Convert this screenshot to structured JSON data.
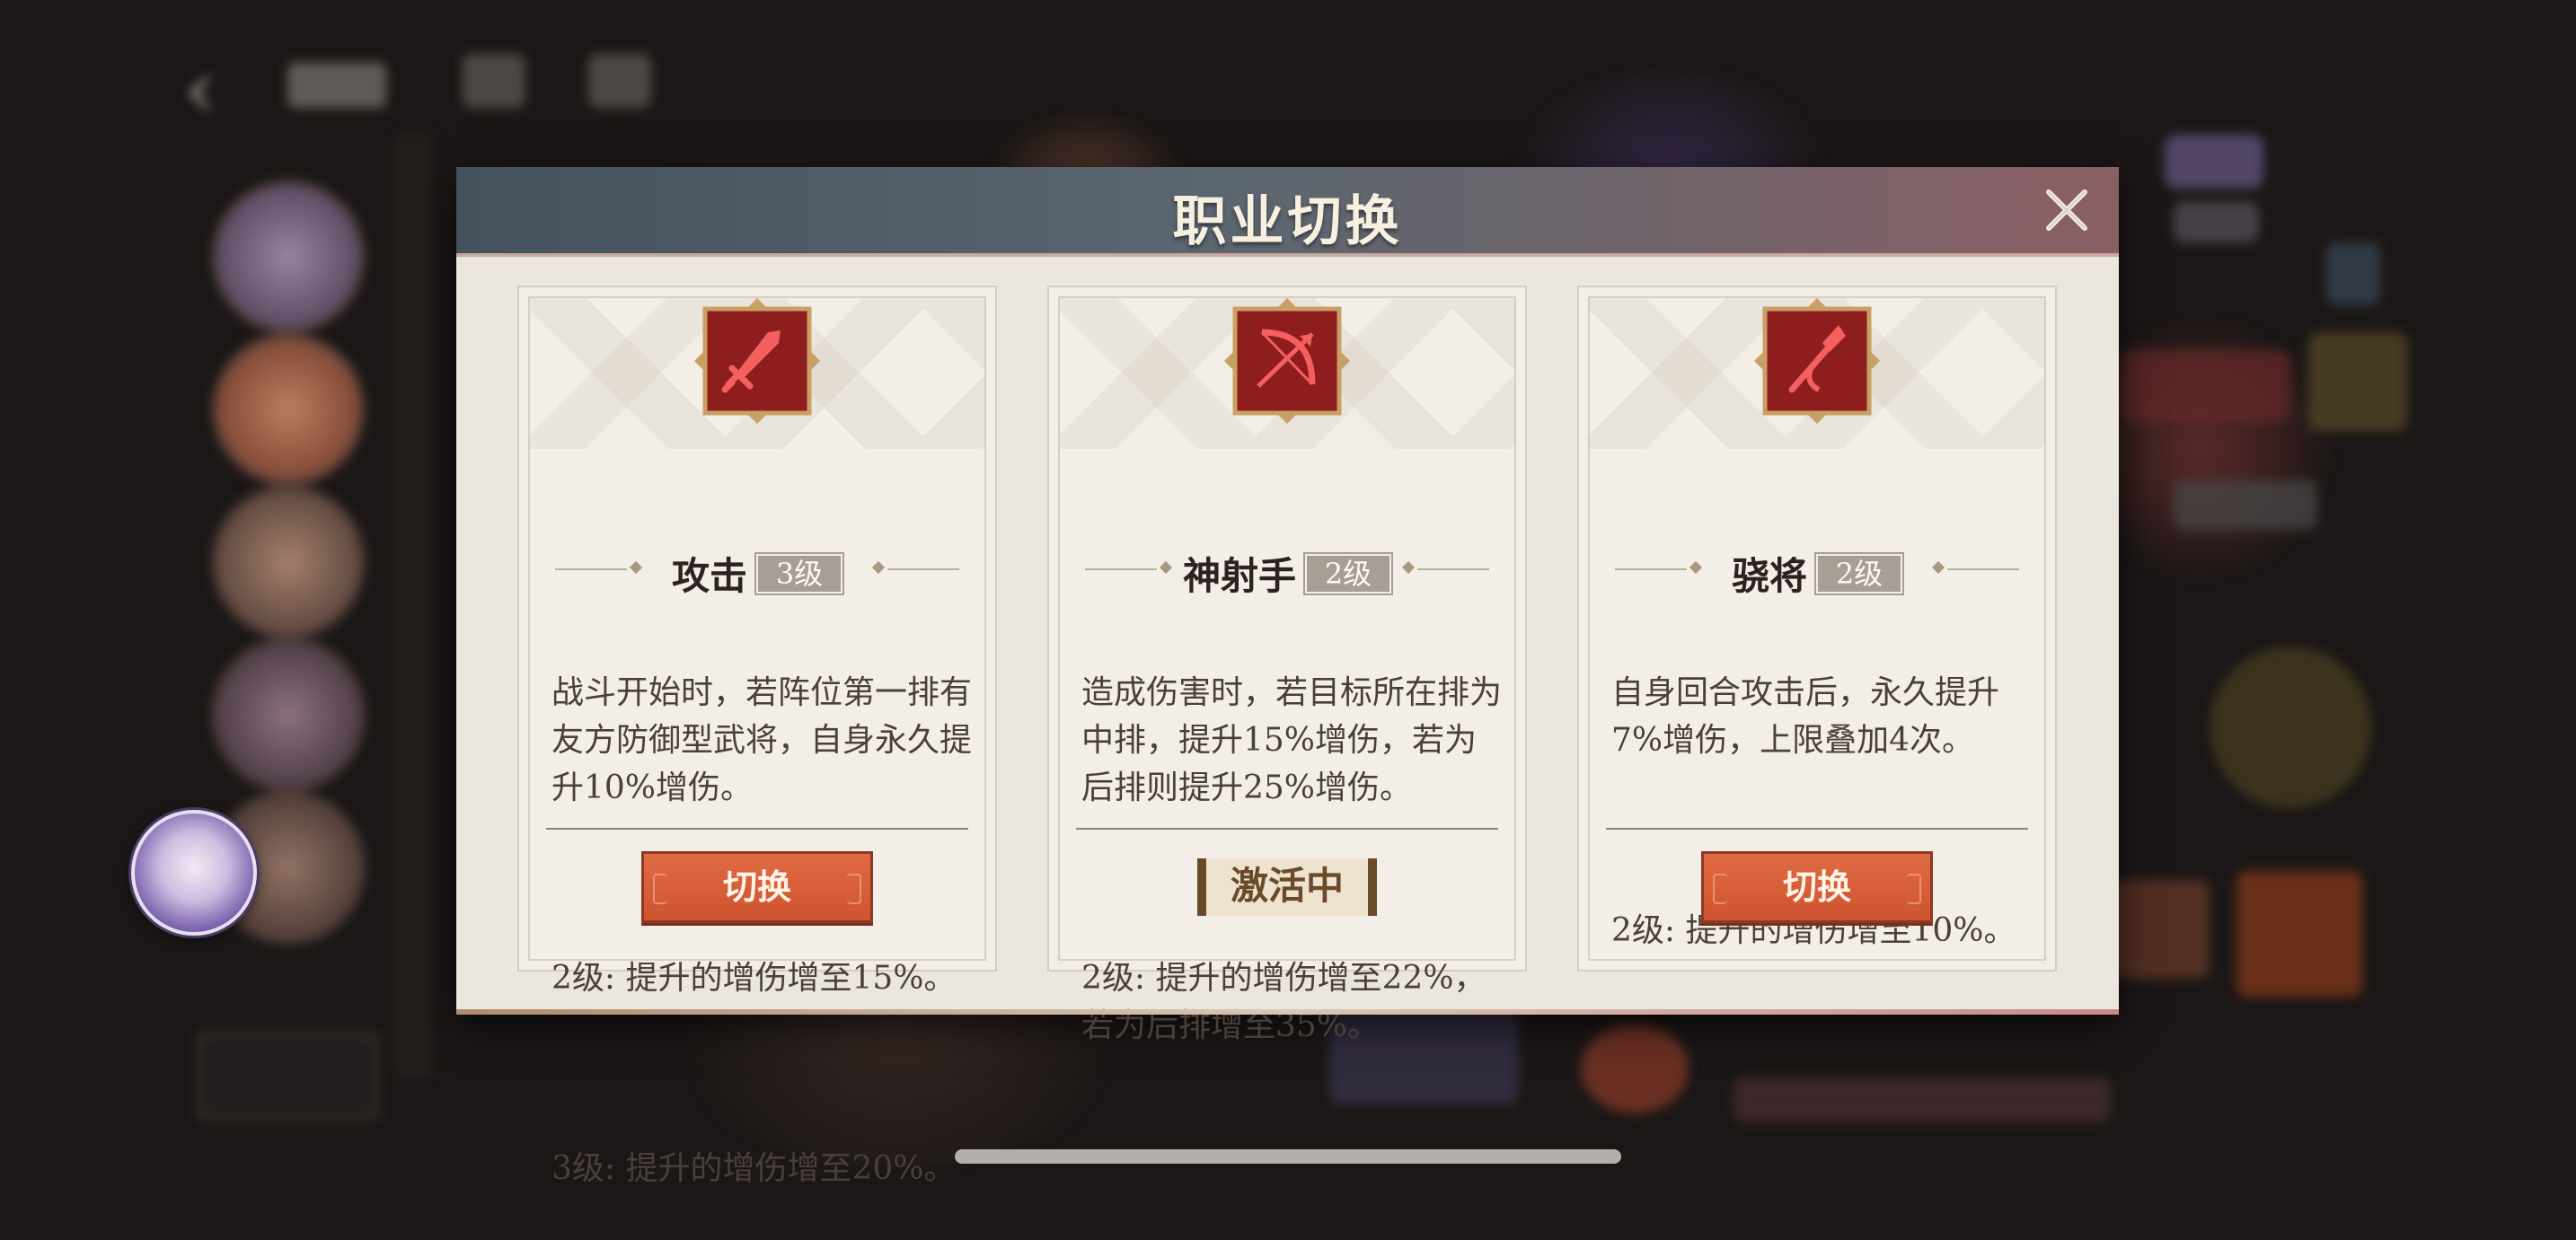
{
  "dialog": {
    "title": "职业切换",
    "close_icon": "close-icon"
  },
  "cards": [
    {
      "icon": "sword-icon",
      "name": "攻击",
      "level": "3级",
      "paragraphs": [
        "战斗开始时，若阵位第一排有友方防御型武将，自身永久提升10%增伤。",
        "2级: 提升的增伤增至15%。",
        "3级: 提升的增伤增至20%。"
      ],
      "action": {
        "type": "button",
        "label": "切换"
      }
    },
    {
      "icon": "bow-icon",
      "name": "神射手",
      "level": "2级",
      "paragraphs": [
        "造成伤害时，若目标所在排为中排，提升15%增伤，若为后排则提升25%增伤。",
        "2级: 提升的增伤增至22%，若为后排增至35%。"
      ],
      "action": {
        "type": "status",
        "label": "激活中"
      }
    },
    {
      "icon": "spear-icon",
      "name": "骁将",
      "level": "2级",
      "paragraphs": [
        "自身回合攻击后，永久提升7%增伤，上限叠加4次。",
        "2级: 提升的增伤增至10%。"
      ],
      "action": {
        "type": "button",
        "label": "切换"
      }
    }
  ],
  "colors": {
    "header": "#4f5d68",
    "panel": "#ebe6de",
    "icon_bg": "#8e1d1d",
    "icon_frame": "#c9a064",
    "button": "#d65a35",
    "active_text": "#6b4a2c"
  }
}
